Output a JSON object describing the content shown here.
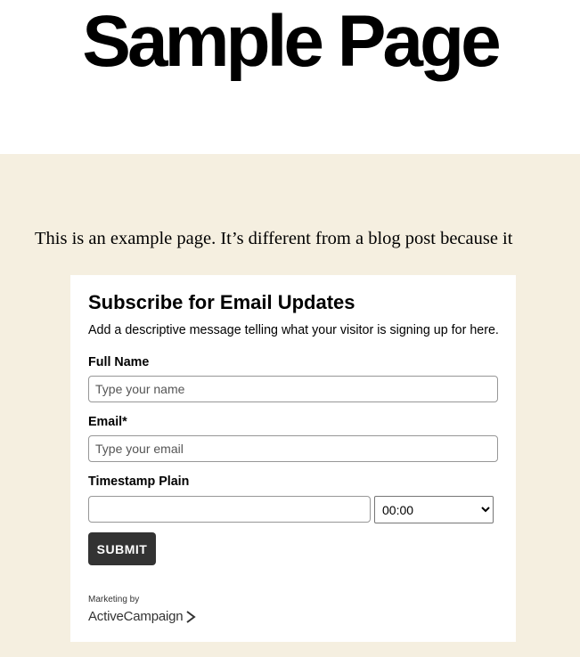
{
  "page": {
    "title": "Sample Page",
    "intro_text": "This is an example page. It’s different from a blog post because it"
  },
  "form": {
    "heading": "Subscribe for Email Updates",
    "description": "Add a descriptive message telling what your visitor is signing up for here.",
    "fields": {
      "full_name": {
        "label": "Full Name",
        "placeholder": "Type your name",
        "value": ""
      },
      "email": {
        "label": "Email*",
        "placeholder": "Type your email",
        "value": ""
      },
      "timestamp": {
        "label": "Timestamp Plain",
        "date_value": "",
        "time_selected": "00:00"
      }
    },
    "submit_label": "SUBMIT",
    "marketing_by": "Marketing by",
    "brand_name": "ActiveCampaign"
  },
  "icons": {
    "brand_chevron": "chevron-right-icon",
    "select_arrow": "chevron-down-icon"
  },
  "colors": {
    "content_background": "#f5efe0",
    "card_background": "#ffffff",
    "button_background": "#333333",
    "button_text": "#ffffff",
    "title_text": "#000000"
  }
}
